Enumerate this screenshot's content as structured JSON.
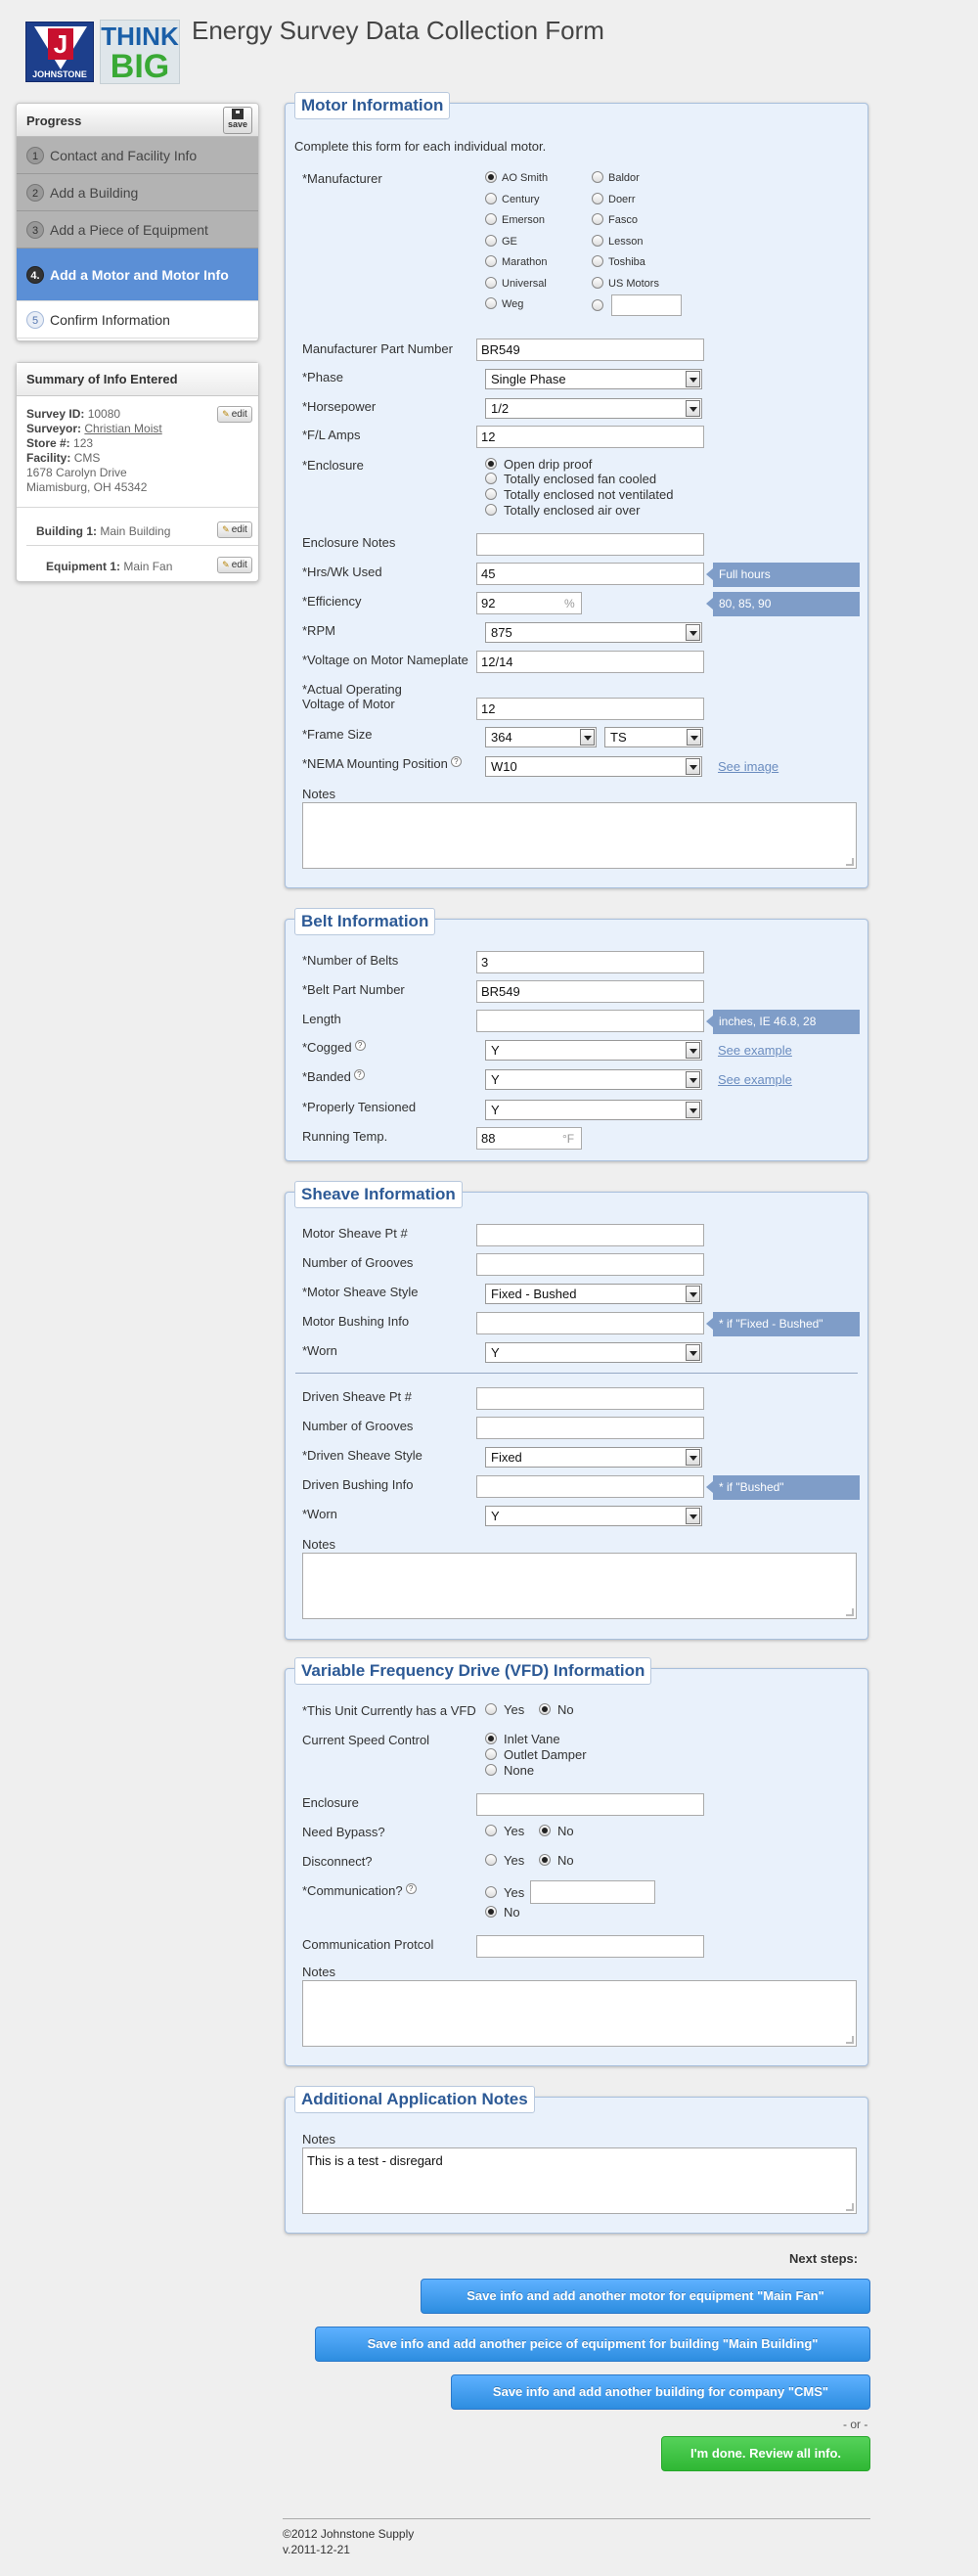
{
  "app": {
    "title": "Energy Survey Data Collection Form",
    "logo_j_letter": "J",
    "logo_j_text": "JOHNSTONE",
    "logo_think": "THINK",
    "logo_big": "BIG"
  },
  "progress": {
    "title": "Progress",
    "save_label": "save",
    "steps": [
      {
        "num": "1",
        "label": "Contact and Facility Info"
      },
      {
        "num": "2",
        "label": "Add a Building"
      },
      {
        "num": "3",
        "label": "Add a Piece of Equipment"
      },
      {
        "num": "4.",
        "label": "Add a Motor and Motor Info"
      },
      {
        "num": "5",
        "label": "Confirm Information"
      }
    ]
  },
  "summary": {
    "title": "Summary of Info Entered",
    "edit_label": "edit",
    "survey_id_label": "Survey ID:",
    "survey_id": "10080",
    "surveyor_label": "Surveyor:",
    "surveyor": "Christian Moist",
    "store_label": "Store #:",
    "store": "123",
    "facility_label": "Facility:",
    "facility": "CMS",
    "address1": "1678 Carolyn Drive",
    "address2": "Miamisburg, OH 45342",
    "building_label": "Building 1:",
    "building": "Main Building",
    "equipment_label": "Equipment 1:",
    "equipment": "Main Fan"
  },
  "motor": {
    "legend": "Motor Information",
    "intro": "Complete this form for each individual motor.",
    "manufacturer_label": "*Manufacturer",
    "manufacturers_left": [
      "AO Smith",
      "Century",
      "Emerson",
      "GE",
      "Marathon",
      "Universal",
      "Weg"
    ],
    "manufacturers_right": [
      "Baldor",
      "Doerr",
      "Fasco",
      "Lesson",
      "Toshiba",
      "US Motors"
    ],
    "part_number_label": "Manufacturer Part Number",
    "part_number": "BR549",
    "phase_label": "*Phase",
    "phase": "Single Phase",
    "hp_label": "*Horsepower",
    "hp": "1/2",
    "fl_amps_label": "*F/L Amps",
    "fl_amps": "12",
    "enclosure_label": "*Enclosure",
    "enclosure_options": [
      "Open drip proof",
      "Totally enclosed fan cooled",
      "Totally enclosed not ventilated",
      "Totally enclosed air over"
    ],
    "enclosure_notes_label": "Enclosure Notes",
    "hrs_label": "*Hrs/Wk Used",
    "hrs": "45",
    "hrs_hint": "Full hours",
    "eff_label": "*Efficiency",
    "eff": "92",
    "eff_unit": "%",
    "eff_hint": "80, 85, 90",
    "rpm_label": "*RPM",
    "rpm": "875",
    "voltage_label": "*Voltage on Motor Nameplate",
    "voltage": "12/14",
    "actual_voltage_label1": "*Actual Operating",
    "actual_voltage_label2": "Voltage of Motor",
    "actual_voltage": "12",
    "frame_label": "*Frame Size",
    "frame1": "364",
    "frame2": "TS",
    "nema_label": "*NEMA Mounting Position",
    "nema": "W10",
    "see_image": "See image",
    "notes_label": "Notes"
  },
  "belt": {
    "legend": "Belt Information",
    "num_label": "*Number of Belts",
    "num": "3",
    "part_label": "*Belt Part Number",
    "part": "BR549",
    "length_label": "Length",
    "length_hint": "inches, IE 46.8, 28",
    "cogged_label": "*Cogged",
    "cogged": "Y",
    "banded_label": "*Banded",
    "banded": "Y",
    "tension_label": "*Properly Tensioned",
    "tension": "Y",
    "temp_label": "Running Temp.",
    "temp": "88",
    "temp_unit": "°F",
    "see_example": "See example"
  },
  "sheave": {
    "legend": "Sheave Information",
    "motor_pt_label": "Motor Sheave Pt #",
    "grooves_label": "Number of Grooves",
    "motor_style_label": "*Motor Sheave Style",
    "motor_style": "Fixed - Bushed",
    "motor_bushing_label": "Motor Bushing Info",
    "motor_bushing_hint": "* if \"Fixed - Bushed\"",
    "worn_label": "*Worn",
    "worn1": "Y",
    "driven_pt_label": "Driven Sheave Pt #",
    "driven_grooves_label": "Number of Grooves",
    "driven_style_label": "*Driven Sheave Style",
    "driven_style": "Fixed",
    "driven_bushing_label": "Driven Bushing Info",
    "driven_bushing_hint": "* if \"Bushed\"",
    "worn2": "Y",
    "notes_label": "Notes"
  },
  "vfd": {
    "legend": "Variable Frequency Drive (VFD) Information",
    "has_vfd_label": "*This Unit Currently has a VFD",
    "yes": "Yes",
    "no": "No",
    "speed_label": "Current Speed Control",
    "speed_options": [
      "Inlet Vane",
      "Outlet Damper",
      "None"
    ],
    "enclosure_label": "Enclosure",
    "bypass_label": "Need Bypass?",
    "disconnect_label": "Disconnect?",
    "comm_label": "*Communication?",
    "protocol_label": "Communication Protcol",
    "notes_label": "Notes"
  },
  "additional": {
    "legend": "Additional Application Notes",
    "notes_label": "Notes",
    "notes": "This is a test - disregard"
  },
  "next": {
    "title": "Next steps:",
    "btn_motor": "Save info and add another motor for equipment \"Main Fan\"",
    "btn_equipment": "Save info and add another peice of equipment for building \"Main Building\"",
    "btn_building": "Save info and add another building for company \"CMS\"",
    "or": "- or -",
    "btn_done": "I'm done. Review all info."
  },
  "footer": {
    "copyright": "©2012 Johnstone Supply",
    "version": "v.2011-12-21"
  }
}
